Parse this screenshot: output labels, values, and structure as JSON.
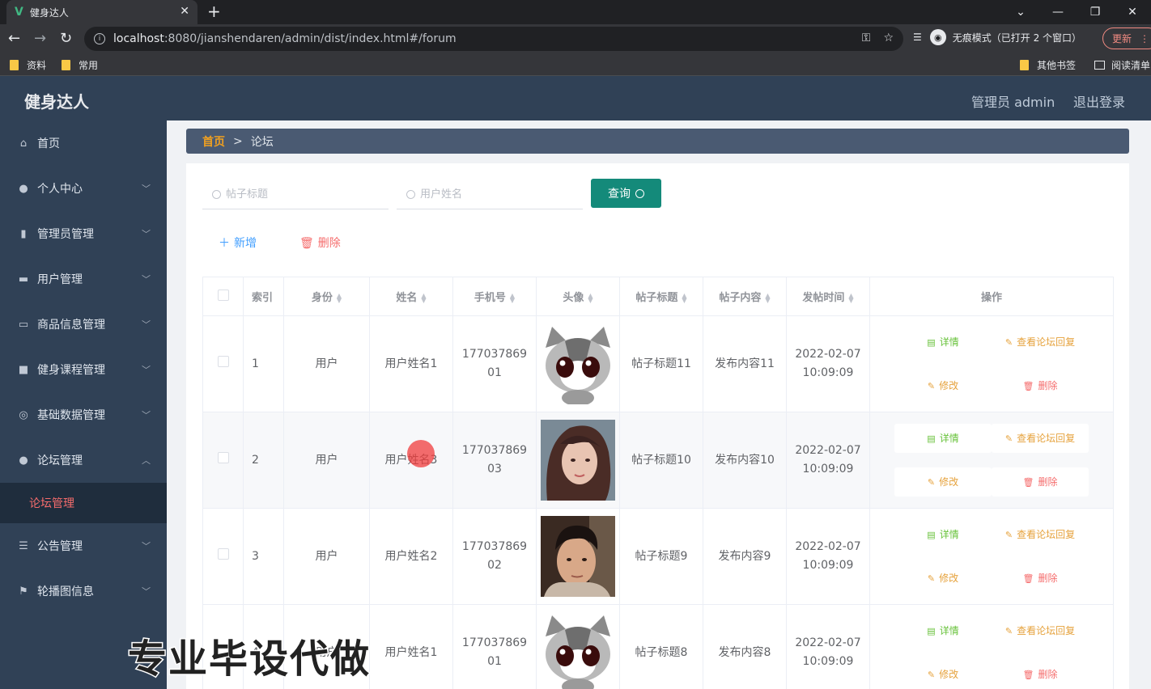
{
  "browser": {
    "tab_title": "健身达人",
    "tab_logo": "V",
    "url_host": "localhost",
    "url_path": ":8080/jianshendaren/admin/dist/index.html#/forum",
    "incognito_label": "无痕模式（已打开 2 个窗口）",
    "update_label": "更新",
    "bookmarks": [
      "资料",
      "常用"
    ],
    "bookmarks_right": [
      "其他书签",
      "阅读清单"
    ]
  },
  "header": {
    "app_title": "健身达人",
    "admin_label": "管理员 admin",
    "logout_label": "退出登录"
  },
  "sidebar": {
    "items": [
      {
        "label": "首页",
        "icon": "home-icon"
      },
      {
        "label": "个人中心",
        "icon": "user-icon"
      },
      {
        "label": "管理员管理",
        "icon": "bar-chart-icon"
      },
      {
        "label": "用户管理",
        "icon": "vendor-icon"
      },
      {
        "label": "商品信息管理",
        "icon": "chat-icon"
      },
      {
        "label": "健身课程管理",
        "icon": "briefcase-icon"
      },
      {
        "label": "基础数据管理",
        "icon": "target-icon"
      },
      {
        "label": "论坛管理",
        "icon": "user-icon"
      },
      {
        "label": "公告管理",
        "icon": "list-icon"
      },
      {
        "label": "轮播图信息",
        "icon": "flag-icon"
      }
    ],
    "active_sub": "论坛管理"
  },
  "breadcrumb": {
    "home": "首页",
    "sep": ">",
    "current": "论坛"
  },
  "search": {
    "title_placeholder": "帖子标题",
    "name_placeholder": "用户姓名",
    "query_label": "查询"
  },
  "actions": {
    "add_label": "新增",
    "delete_label": "删除"
  },
  "table": {
    "headers": [
      "索引",
      "身份",
      "姓名",
      "手机号",
      "头像",
      "帖子标题",
      "帖子内容",
      "发帖时间",
      "操作"
    ],
    "ops": {
      "detail": "详情",
      "replies": "查看论坛回复",
      "edit": "修改",
      "remove": "删除"
    },
    "rows": [
      {
        "index": "1",
        "role": "用户",
        "name": "用户姓名1",
        "phone_a": "177037869",
        "phone_b": "01",
        "title": "帖子标题11",
        "content": "发布内容11",
        "date": "2022-02-07",
        "time": "10:09:09",
        "avatar": "cat"
      },
      {
        "index": "2",
        "role": "用户",
        "name": "用户姓名3",
        "phone_a": "177037869",
        "phone_b": "03",
        "title": "帖子标题10",
        "content": "发布内容10",
        "date": "2022-02-07",
        "time": "10:09:09",
        "avatar": "woman"
      },
      {
        "index": "3",
        "role": "用户",
        "name": "用户姓名2",
        "phone_a": "177037869",
        "phone_b": "02",
        "title": "帖子标题9",
        "content": "发布内容9",
        "date": "2022-02-07",
        "time": "10:09:09",
        "avatar": "man"
      },
      {
        "index": "4",
        "role": "用户",
        "name": "用户姓名1",
        "phone_a": "177037869",
        "phone_b": "01",
        "title": "帖子标题8",
        "content": "发布内容8",
        "date": "2022-02-07",
        "time": "10:09:09",
        "avatar": "cat"
      }
    ]
  },
  "watermark": "专业毕设代做"
}
